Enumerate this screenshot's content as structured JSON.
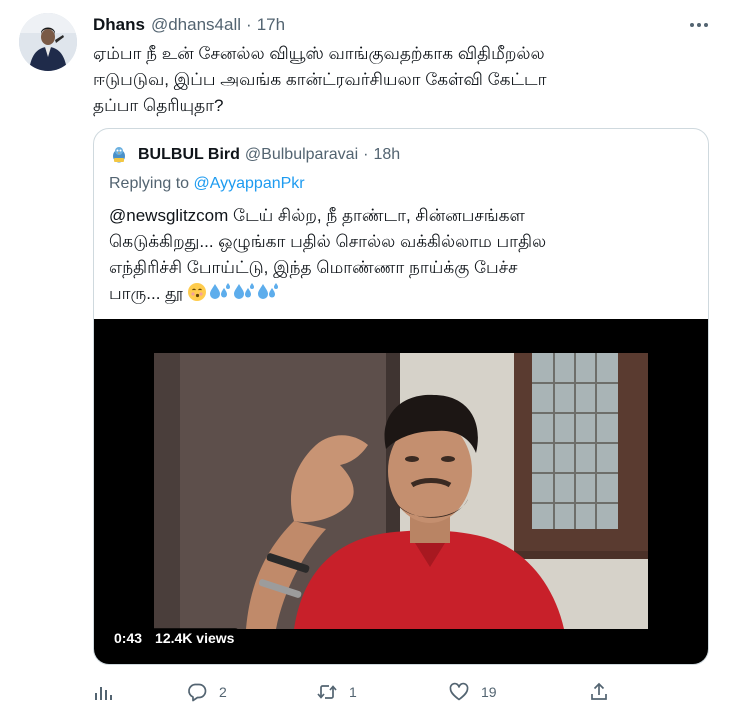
{
  "tweet": {
    "author_name": "Dhans",
    "author_handle": "@dhans4all",
    "separator": "·",
    "timestamp": "17h",
    "text_lines": [
      "ஏம்பா நீ உன் சேனல்ல வியூஸ் வாங்குவதற்காக விதிமீறல்ல",
      "ஈடுபடுவ, இப்ப அவங்க கான்ட்ரவர்சியலா கேள்வி கேட்டா",
      "தப்பா தெரியுதா?"
    ]
  },
  "quote": {
    "author_name": "BULBUL Bird",
    "author_handle": "@Bulbulparavai",
    "separator": "·",
    "timestamp": "18h",
    "replying_label": "Replying to",
    "replying_handle": "@AyyappanPkr",
    "text_lines": [
      "@newsglitzcom டேய் சில்ற, நீ தாண்டா, சின்னபசங்கள",
      "கெடுக்கிறது... ஒழுங்கா பதில் சொல்ல வக்கில்லாம பாதில",
      "எந்திரிச்சி போய்ட்டு, இந்த மொண்ணா நாய்க்கு பேச்ச",
      "பாரு... தூ"
    ],
    "emojis": [
      "kissing-face-emoji",
      "sweat-droplets-emoji",
      "sweat-droplets-emoji",
      "sweat-droplets-emoji"
    ],
    "video": {
      "duration": "0:43",
      "views": "12.4K views"
    }
  },
  "actions": {
    "analytics_icon": "analytics-icon",
    "reply_count": "2",
    "retweet_count": "1",
    "like_count": "19",
    "share_icon": "share-icon"
  },
  "colors": {
    "text_primary": "#0f1419",
    "text_secondary": "#536471",
    "link": "#1d9bf0",
    "border": "#cfd9de"
  }
}
